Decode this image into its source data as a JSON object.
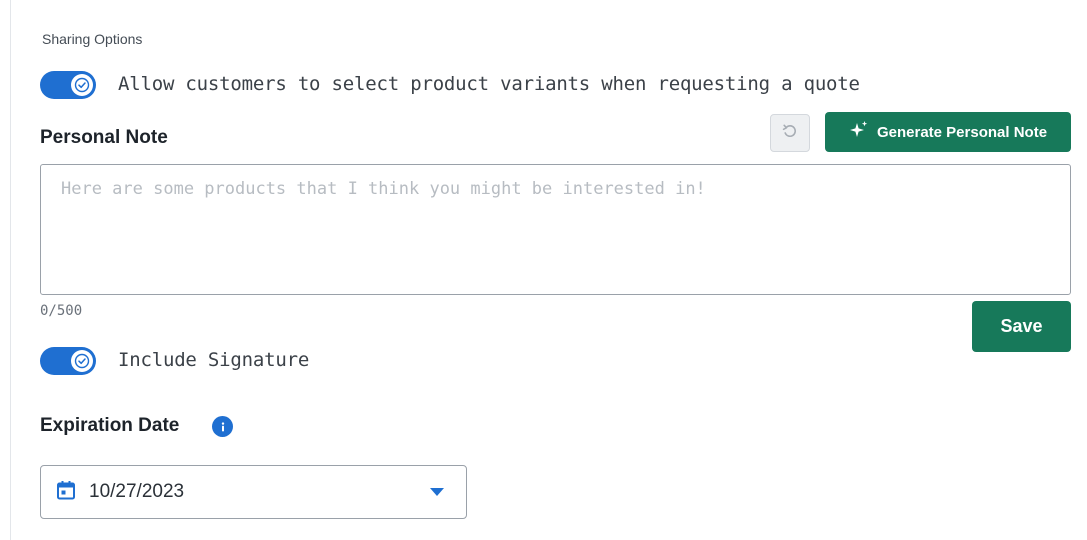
{
  "section": {
    "title": "Sharing Options"
  },
  "variants_toggle": {
    "label": "Allow customers to select product variants when requesting a quote",
    "checked": true
  },
  "personal_note": {
    "label": "Personal Note",
    "generate_button_label": "Generate Personal Note",
    "placeholder": "Here are some products that I think you might be interested in!",
    "value": "",
    "counter": "0/500",
    "save_label": "Save"
  },
  "signature_toggle": {
    "label": "Include Signature",
    "checked": true
  },
  "expiration": {
    "label": "Expiration Date",
    "date_value": "10/27/2023"
  },
  "icons": {
    "toggle_knob": "check-icon",
    "undo": "undo-icon",
    "generate": "sparkle-icon",
    "info": "info-icon",
    "calendar": "calendar-icon",
    "dropdown": "caret-down-icon"
  },
  "colors": {
    "primary_blue": "#1f6fd1",
    "primary_green": "#17795a",
    "border": "#9aa1a9",
    "placeholder_text": "#b7bcc2"
  }
}
